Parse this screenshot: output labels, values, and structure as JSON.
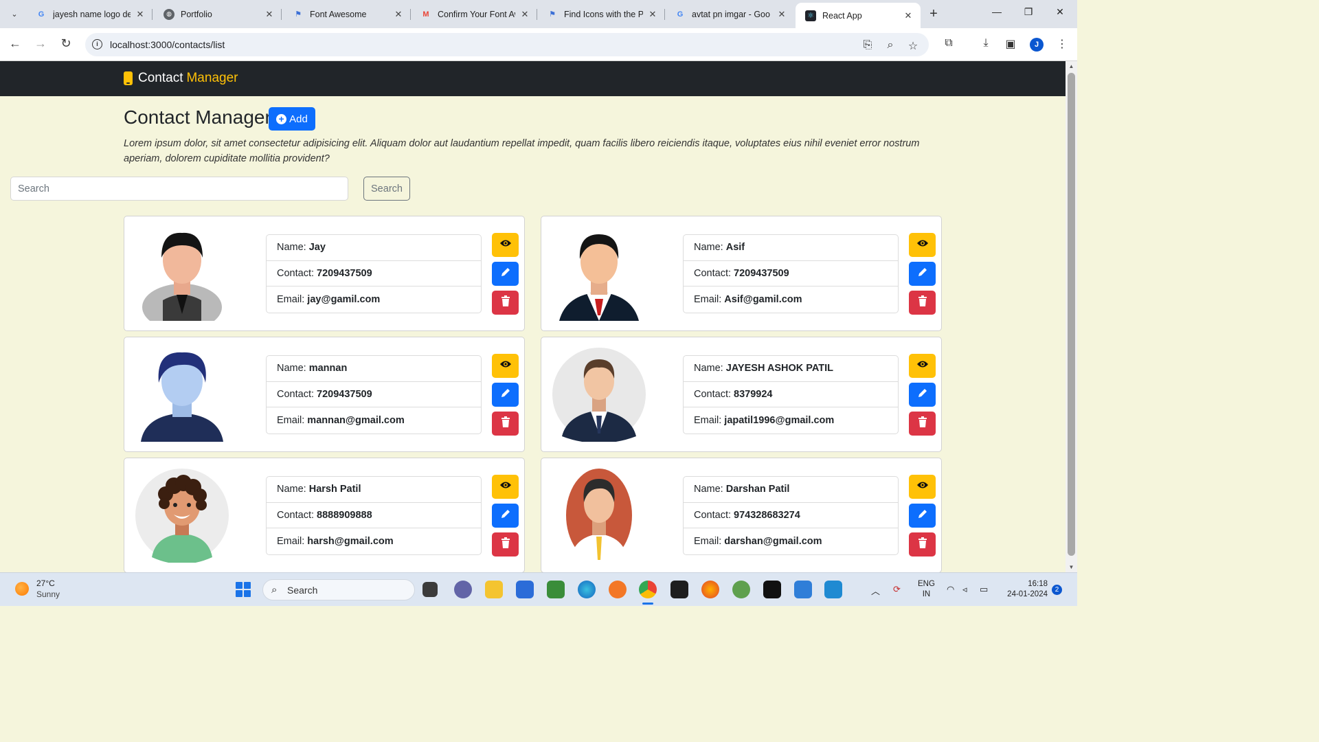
{
  "browser": {
    "tabs": [
      {
        "title": "jayesh name logo de",
        "favicon": "google-icon"
      },
      {
        "title": "Portfolio",
        "favicon": "globe-icon"
      },
      {
        "title": "Font Awesome",
        "favicon": "flag-icon"
      },
      {
        "title": "Confirm Your Font Aw",
        "favicon": "gmail-icon"
      },
      {
        "title": "Find Icons with the P",
        "favicon": "flag-icon"
      },
      {
        "title": "avtat pn imgar - Goo",
        "favicon": "google-icon"
      },
      {
        "title": "React App",
        "favicon": "react-icon",
        "active": true
      }
    ],
    "url": "localhost:3000/contacts/list",
    "profile_initial": "J"
  },
  "app": {
    "brand": {
      "word1": "Contact",
      "word2": "Manager"
    },
    "heading": "Contact Manager",
    "add_label": "Add",
    "description": "Lorem ipsum dolor, sit amet consectetur adipisicing elit. Aliquam dolor aut laudantium repellat impedit, quam facilis libero reiciendis itaque, voluptates eius nihil eveniet error nostrum aperiam, dolorem cupiditate mollitia provident?",
    "search": {
      "placeholder": "Search",
      "button_label": "Search"
    },
    "field_labels": {
      "name": "Name:",
      "contact": "Contact:",
      "email": "Email:"
    },
    "colors": {
      "navbar": "#212529",
      "accent": "#ffc107",
      "primary": "#0d6efd",
      "danger": "#dc3545",
      "page_bg": "#f5f5dc"
    },
    "contacts": [
      {
        "name": "Jay",
        "contact": "7209437509",
        "email": "jay@gamil.com",
        "avatar": "man-grey-vest-avatar"
      },
      {
        "name": "Asif",
        "contact": "7209437509",
        "email": "Asif@gamil.com",
        "avatar": "man-suit-red-tie-avatar"
      },
      {
        "name": "mannan",
        "contact": "7209437509",
        "email": "mannan@gmail.com",
        "avatar": "blue-silhouette-avatar"
      },
      {
        "name": "JAYESH ASHOK PATIL",
        "contact": "8379924",
        "email": "japatil1996@gmail.com",
        "avatar": "man-navy-suit-avatar"
      },
      {
        "name": "Harsh Patil",
        "contact": "8888909888",
        "email": "harsh@gmail.com",
        "avatar": "curly-hair-boy-avatar"
      },
      {
        "name": "Darshan Patil",
        "contact": "974328683274",
        "email": "darshan@gmail.com",
        "avatar": "man-orange-circle-avatar"
      }
    ]
  },
  "taskbar": {
    "weather": {
      "temp": "27°C",
      "desc": "Sunny"
    },
    "search_label": "Search",
    "lang": {
      "line1": "ENG",
      "line2": "IN"
    },
    "time": "16:18",
    "date": "24-01-2024",
    "notifications": "2"
  }
}
